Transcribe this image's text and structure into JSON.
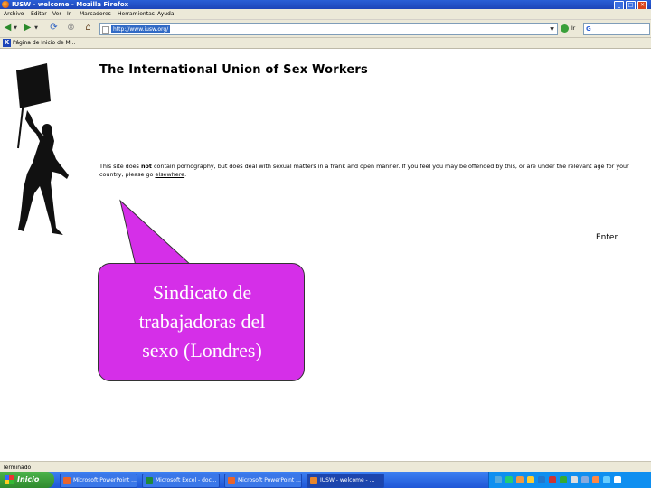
{
  "window": {
    "title": "IUSW - welcome - Mozilla Firefox"
  },
  "menu": [
    "Archivo",
    "Editar",
    "Ver",
    "Ir",
    "Marcadores",
    "Herramientas",
    "Ayuda"
  ],
  "toolbar": {
    "url": "http://www.iusw.org/",
    "go_label": "Ir",
    "search_engine_icon": "G"
  },
  "bookmarks": {
    "icon_letter": "K",
    "item": "Página de Inicio de M..."
  },
  "page": {
    "title": "The International Union of Sex Workers",
    "warning_before": "This site does ",
    "warning_bold": "not",
    "warning_after": " contain pornography, but does deal with sexual matters in a frank and open manner. If you feel you may be offended by this, or are under the relevant age for your country, please go ",
    "warning_link": "elsewhere",
    "warning_end": ".",
    "enter_label": "Enter"
  },
  "callout": {
    "lines": [
      "Sindicato de",
      "trabajadoras del",
      "sexo (Londres)"
    ],
    "color": "#d52fe8"
  },
  "status": {
    "text": "Terminado"
  },
  "taskbar": {
    "start_label": "Inicio",
    "tasks": [
      {
        "label": "Microsoft PowerPoint ...",
        "icon_color": "#e8642c"
      },
      {
        "label": "Microsoft Excel - doc...",
        "icon_color": "#1f8a3a"
      },
      {
        "label": "Microsoft PowerPoint ...",
        "icon_color": "#e8642c"
      },
      {
        "label": "IUSW - welcome - ...",
        "icon_color": "#e8862c"
      }
    ]
  }
}
